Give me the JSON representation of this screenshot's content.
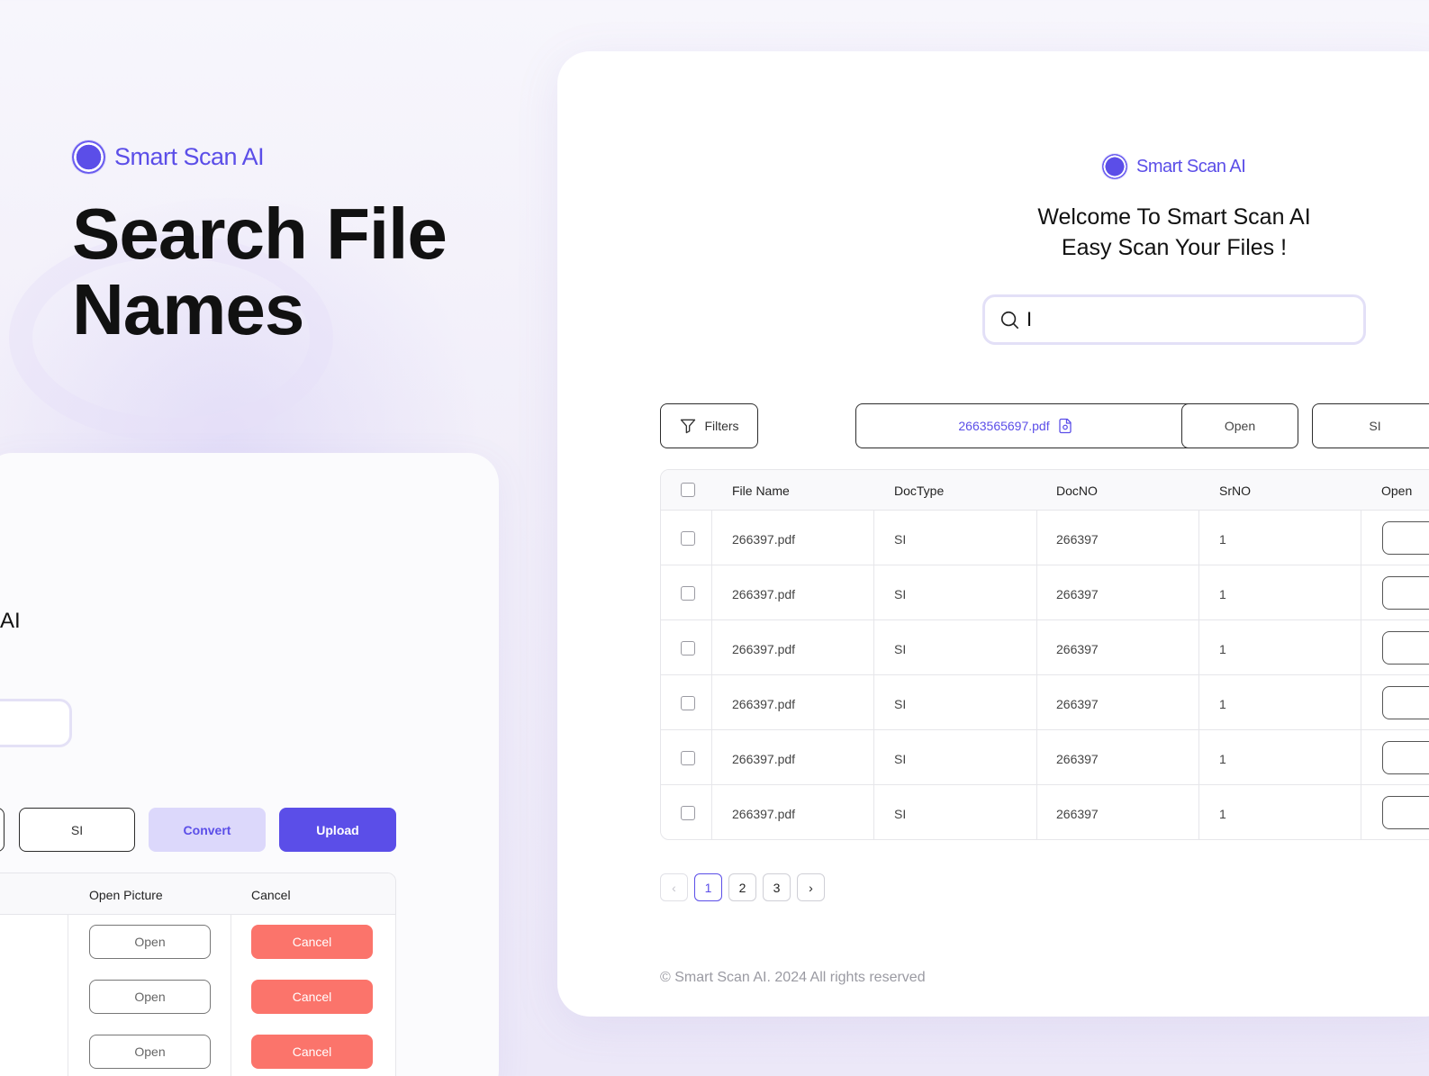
{
  "brand": {
    "name": "Smart Scan AI"
  },
  "hero": {
    "line1": "Search File",
    "line2": "Names"
  },
  "left_panel": {
    "partial_title": "AI",
    "buttons": {
      "si": "SI",
      "convert": "Convert",
      "upload": "Upload"
    },
    "table": {
      "headers": [
        "Open Picture",
        "Cancel"
      ],
      "open_label": "Open",
      "cancel_label": "Cancel"
    }
  },
  "main": {
    "welcome_line1": "Welcome To Smart Scan AI",
    "welcome_line2": "Easy Scan Your Files !",
    "search": {
      "value": "I"
    },
    "toolbar": {
      "filters": "Filters",
      "file_chip": "2663565697.pdf",
      "open": "Open",
      "si": "SI"
    },
    "table": {
      "headers": {
        "file_name": "File Name",
        "doctype": "DocType",
        "docno": "DocNO",
        "srno": "SrNO",
        "open": "Open"
      },
      "rows": [
        {
          "file_name": "266397.pdf",
          "doctype": "SI",
          "docno": "266397",
          "srno": "1"
        },
        {
          "file_name": "266397.pdf",
          "doctype": "SI",
          "docno": "266397",
          "srno": "1"
        },
        {
          "file_name": "266397.pdf",
          "doctype": "SI",
          "docno": "266397",
          "srno": "1"
        },
        {
          "file_name": "266397.pdf",
          "doctype": "SI",
          "docno": "266397",
          "srno": "1"
        },
        {
          "file_name": "266397.pdf",
          "doctype": "SI",
          "docno": "266397",
          "srno": "1"
        },
        {
          "file_name": "266397.pdf",
          "doctype": "SI",
          "docno": "266397",
          "srno": "1"
        }
      ]
    },
    "pagination": {
      "prev": "‹",
      "pages": [
        "1",
        "2",
        "3"
      ],
      "next": "›",
      "current": "1"
    },
    "footer": "© Smart Scan AI. 2024 All rights reserved"
  },
  "icons": {
    "logo": "brand-logo-icon",
    "search": "search-icon",
    "filter": "filter-icon",
    "file": "file-icon",
    "prev": "chevron-left-icon",
    "next": "chevron-right-icon"
  },
  "colors": {
    "accent": "#5b4ee8",
    "accent_soft": "#dcd8fb",
    "danger": "#fb746b",
    "muted_text": "#9a9aa2"
  }
}
